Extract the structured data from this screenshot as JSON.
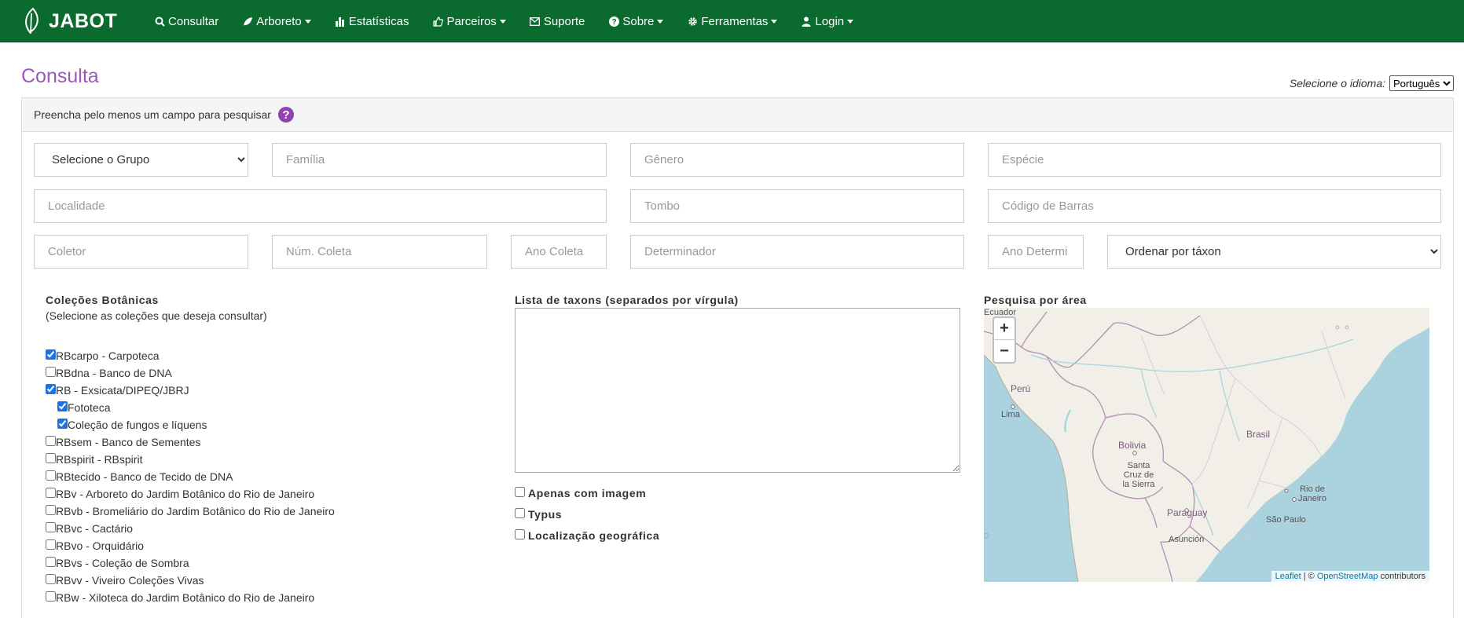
{
  "brand": {
    "name": "JABOT"
  },
  "nav": [
    {
      "label": "Consultar",
      "icon": "search-icon",
      "dropdown": false
    },
    {
      "label": "Arboreto",
      "icon": "leaf-icon",
      "dropdown": true
    },
    {
      "label": "Estatísticas",
      "icon": "bar-chart-icon",
      "dropdown": false
    },
    {
      "label": "Parceiros",
      "icon": "thumbs-up-icon",
      "dropdown": true
    },
    {
      "label": "Suporte",
      "icon": "envelope-icon",
      "dropdown": false
    },
    {
      "label": "Sobre",
      "icon": "question-circle-icon",
      "dropdown": true
    },
    {
      "label": "Ferramentas",
      "icon": "gear-icon",
      "dropdown": true
    },
    {
      "label": "Login",
      "icon": "user-icon",
      "dropdown": true
    }
  ],
  "page": {
    "title": "Consulta"
  },
  "language": {
    "label": "Selecione o idioma:",
    "selected": "Português"
  },
  "panel": {
    "hint": "Preencha pelo menos um campo para pesquisar",
    "help_icon": "?"
  },
  "search": {
    "group_select": "Selecione o Grupo",
    "familia": "Família",
    "genero": "Gênero",
    "especie": "Espécie",
    "localidade": "Localidade",
    "tombo": "Tombo",
    "codigo_barras": "Código de Barras",
    "coletor": "Coletor",
    "num_coleta": "Núm. Coleta",
    "ano_coleta": "Ano Coleta",
    "determinador": "Determinador",
    "ano_determ": "Ano Determi",
    "ordenar": "Ordenar por táxon"
  },
  "collections": {
    "title": "Coleções Botânicas",
    "subtitle": "(Selecione as coleções que deseja consultar)",
    "items": [
      {
        "label": "RBcarpo - Carpoteca",
        "checked": true,
        "indent": false
      },
      {
        "label": "RBdna - Banco de DNA",
        "checked": false,
        "indent": false
      },
      {
        "label": "RB - Exsicata/DIPEQ/JBRJ",
        "checked": true,
        "indent": false
      },
      {
        "label": "Fototeca",
        "checked": true,
        "indent": true
      },
      {
        "label": "Coleção de fungos e líquens",
        "checked": true,
        "indent": true
      },
      {
        "label": "RBsem - Banco de Sementes",
        "checked": false,
        "indent": false
      },
      {
        "label": "RBspirit - RBspirit",
        "checked": false,
        "indent": false
      },
      {
        "label": "RBtecido - Banco de Tecido de DNA",
        "checked": false,
        "indent": false
      },
      {
        "label": "RBv - Arboreto do Jardim Botânico do Rio de Janeiro",
        "checked": false,
        "indent": false
      },
      {
        "label": "RBvb - Bromeliário do Jardim Botânico do Rio de Janeiro",
        "checked": false,
        "indent": false
      },
      {
        "label": "RBvc - Cactário",
        "checked": false,
        "indent": false
      },
      {
        "label": "RBvo - Orquidário",
        "checked": false,
        "indent": false
      },
      {
        "label": "RBvs - Coleção de Sombra",
        "checked": false,
        "indent": false
      },
      {
        "label": "RBvv - Viveiro Coleções Vivas",
        "checked": false,
        "indent": false
      },
      {
        "label": "RBw - Xiloteca do Jardim Botânico do Rio de Janeiro",
        "checked": false,
        "indent": false
      }
    ]
  },
  "taxa": {
    "title": "Lista de taxons (separados por vírgula)",
    "value": "",
    "options": [
      {
        "label": "Apenas com imagem",
        "checked": false
      },
      {
        "label": "Typus",
        "checked": false
      },
      {
        "label": "Localização geográfica",
        "checked": false
      }
    ]
  },
  "map": {
    "title": "Pesquisa por área",
    "zoom_in": "+",
    "zoom_out": "−",
    "labels": {
      "ecuador": "Ecuador",
      "peru": "Perú",
      "lima": "Lima",
      "bolivia": "Bolivia",
      "santa_cruz": "Santa Cruz de la Sierra",
      "brasil": "Brasil",
      "paraguay": "Paraguay",
      "asuncion": "Asunción",
      "rio": "Rio de Janeiro",
      "sao_paulo": "São Paulo"
    },
    "attribution": {
      "leaflet": "Leaflet",
      "sep": " | © ",
      "osm": "OpenStreetMap",
      "tail": " contributors"
    }
  }
}
